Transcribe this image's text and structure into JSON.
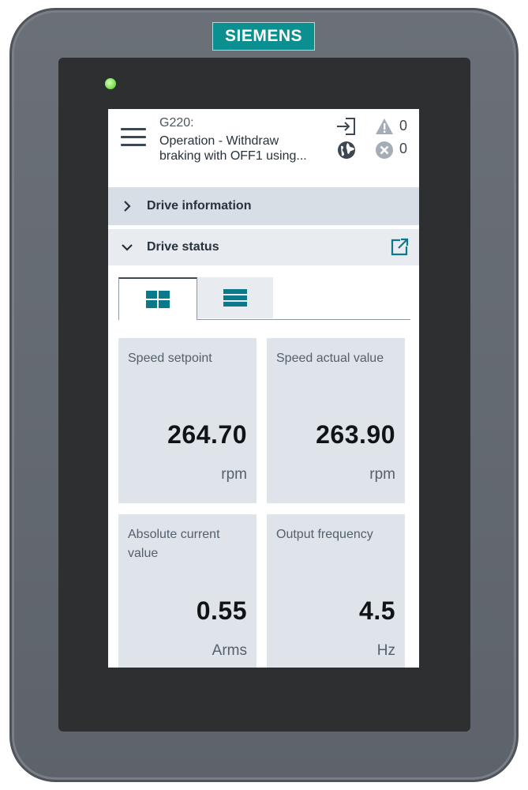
{
  "brand": "SIEMENS",
  "header": {
    "device": "G220:",
    "status_line1": "Operation - Withdraw",
    "status_line2": "braking with OFF1 using...",
    "warnings_count": "0",
    "errors_count": "0"
  },
  "sections": {
    "drive_information": "Drive information",
    "drive_status": "Drive status"
  },
  "tabs": [
    {
      "icon": "tile-view-icon",
      "active": true
    },
    {
      "icon": "list-view-icon",
      "active": false
    }
  ],
  "tiles": [
    {
      "label": "Speed setpoint",
      "value": "264.70",
      "unit": "rpm"
    },
    {
      "label": "Speed actual value",
      "value": "263.90",
      "unit": "rpm"
    },
    {
      "label": "Absolute current value",
      "value": "0.55",
      "unit": "Arms"
    },
    {
      "label": "Output frequency",
      "value": "4.5",
      "unit": "Hz"
    }
  ],
  "colors": {
    "brand": "#0b8f91",
    "accent": "#0a7a8a",
    "housing": "#646a72",
    "status_led": "#86e35e"
  }
}
